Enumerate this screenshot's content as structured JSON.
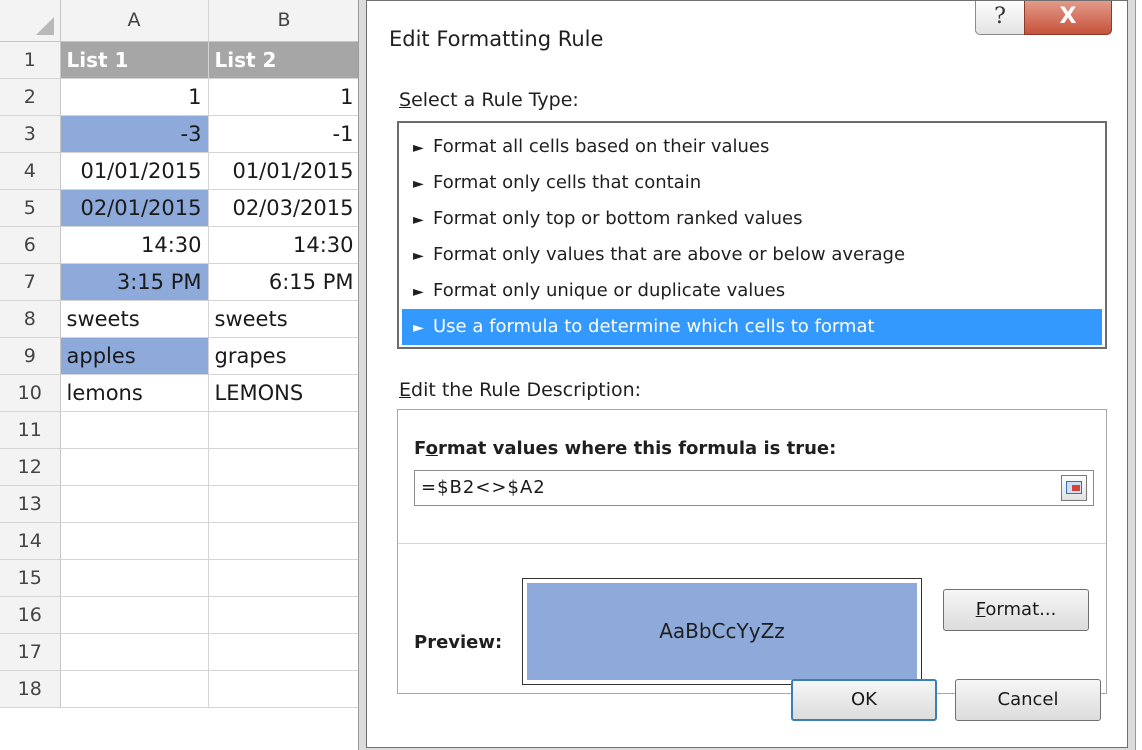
{
  "spreadsheet": {
    "columns": [
      "A",
      "B"
    ],
    "rows": [
      {
        "num": "1",
        "a": "List 1",
        "b": "List 2",
        "a_hl": false,
        "b_hl": false,
        "header": true
      },
      {
        "num": "2",
        "a": "1",
        "b": "1",
        "a_hl": false,
        "align": "num"
      },
      {
        "num": "3",
        "a": "-3",
        "b": "-1",
        "a_hl": true,
        "align": "num"
      },
      {
        "num": "4",
        "a": "01/01/2015",
        "b": "01/01/2015",
        "a_hl": false,
        "align": "num"
      },
      {
        "num": "5",
        "a": "02/01/2015",
        "b": "02/03/2015",
        "a_hl": true,
        "align": "num"
      },
      {
        "num": "6",
        "a": "14:30",
        "b": "14:30",
        "a_hl": false,
        "align": "num"
      },
      {
        "num": "7",
        "a": "3:15 PM",
        "b": "6:15 PM",
        "a_hl": true,
        "align": "num"
      },
      {
        "num": "8",
        "a": "sweets",
        "b": "sweets",
        "a_hl": false,
        "align": "txt"
      },
      {
        "num": "9",
        "a": "apples",
        "b": "grapes",
        "a_hl": true,
        "align": "txt"
      },
      {
        "num": "10",
        "a": "lemons",
        "b": "LEMONS",
        "a_hl": false,
        "align": "txt"
      },
      {
        "num": "11",
        "a": "",
        "b": "",
        "a_hl": false,
        "align": "txt"
      },
      {
        "num": "12",
        "a": "",
        "b": "",
        "a_hl": false,
        "align": "txt"
      },
      {
        "num": "13",
        "a": "",
        "b": "",
        "a_hl": false,
        "align": "txt"
      },
      {
        "num": "14",
        "a": "",
        "b": "",
        "a_hl": false,
        "align": "txt"
      },
      {
        "num": "15",
        "a": "",
        "b": "",
        "a_hl": false,
        "align": "txt"
      },
      {
        "num": "16",
        "a": "",
        "b": "",
        "a_hl": false,
        "align": "txt"
      },
      {
        "num": "17",
        "a": "",
        "b": "",
        "a_hl": false,
        "align": "txt"
      },
      {
        "num": "18",
        "a": "",
        "b": "",
        "a_hl": false,
        "align": "txt"
      }
    ],
    "colors": {
      "highlight": "#8eaadb",
      "header_fill": "#a6a6a6"
    }
  },
  "dialog": {
    "title": "Edit Formatting Rule",
    "help_icon": "help-icon",
    "help_glyph": "?",
    "close_icon": "close-icon",
    "close_glyph": "X",
    "rule_type_label": "Select a Rule Type:",
    "rule_type_label_key": "S",
    "rule_type_label_rest": "elect a Rule Type:",
    "rule_types": [
      "Format all cells based on their values",
      "Format only cells that contain",
      "Format only top or bottom ranked values",
      "Format only values that are above or below average",
      "Format only unique or duplicate values",
      "Use a formula to determine which cells to format"
    ],
    "selected_rule_index": 5,
    "arrow_glyph": "►",
    "description_label_key": "E",
    "description_label_rest": "dit the Rule Description:",
    "formula_label_pre": "F",
    "formula_label_key": "o",
    "formula_label_rest": "rmat values where this formula is true:",
    "formula_value": "=$B2<>$A2",
    "preview_label": "Preview:",
    "preview_text": "AaBbCcYyZz",
    "format_button_key": "F",
    "format_button_rest": "ormat...",
    "ok_label": "OK",
    "cancel_label": "Cancel",
    "colors": {
      "selected": "#3399ff",
      "preview_fill": "#8eaadb",
      "close": "#c7523a"
    }
  }
}
